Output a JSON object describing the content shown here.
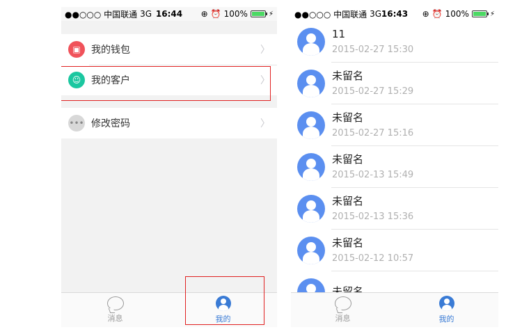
{
  "left": {
    "status": {
      "carrier": "●●○○○ 中国联通",
      "network": "3G",
      "time": "16:44",
      "battery": "100%"
    },
    "menu": [
      {
        "label": "我的钱包",
        "color": "#f0525a"
      },
      {
        "label": "我的客户",
        "color": "#1bc7a0"
      },
      {
        "label": "修改密码",
        "color": "#d8d8d8"
      }
    ],
    "tabs": [
      {
        "label": "消息"
      },
      {
        "label": "我的"
      }
    ]
  },
  "right": {
    "status": {
      "carrier": "●●○○○ 中国联通",
      "network": "3G",
      "time": "16:43",
      "battery": "100%"
    },
    "rows": [
      {
        "name": "11",
        "time": "2015-02-27 15:30"
      },
      {
        "name": "未留名",
        "time": "2015-02-27 15:29"
      },
      {
        "name": "未留名",
        "time": "2015-02-27 15:16"
      },
      {
        "name": "未留名",
        "time": "2015-02-13 15:49"
      },
      {
        "name": "未留名",
        "time": "2015-02-13 15:36"
      },
      {
        "name": "未留名",
        "time": "2015-02-12 10:57"
      },
      {
        "name": "未留名",
        "time": ""
      }
    ],
    "tabs": [
      {
        "label": "消息"
      },
      {
        "label": "我的"
      }
    ]
  },
  "colors": {
    "accent": "#3a7bd5",
    "highlight": "#e02020",
    "avatar": "#5b8ff0"
  }
}
